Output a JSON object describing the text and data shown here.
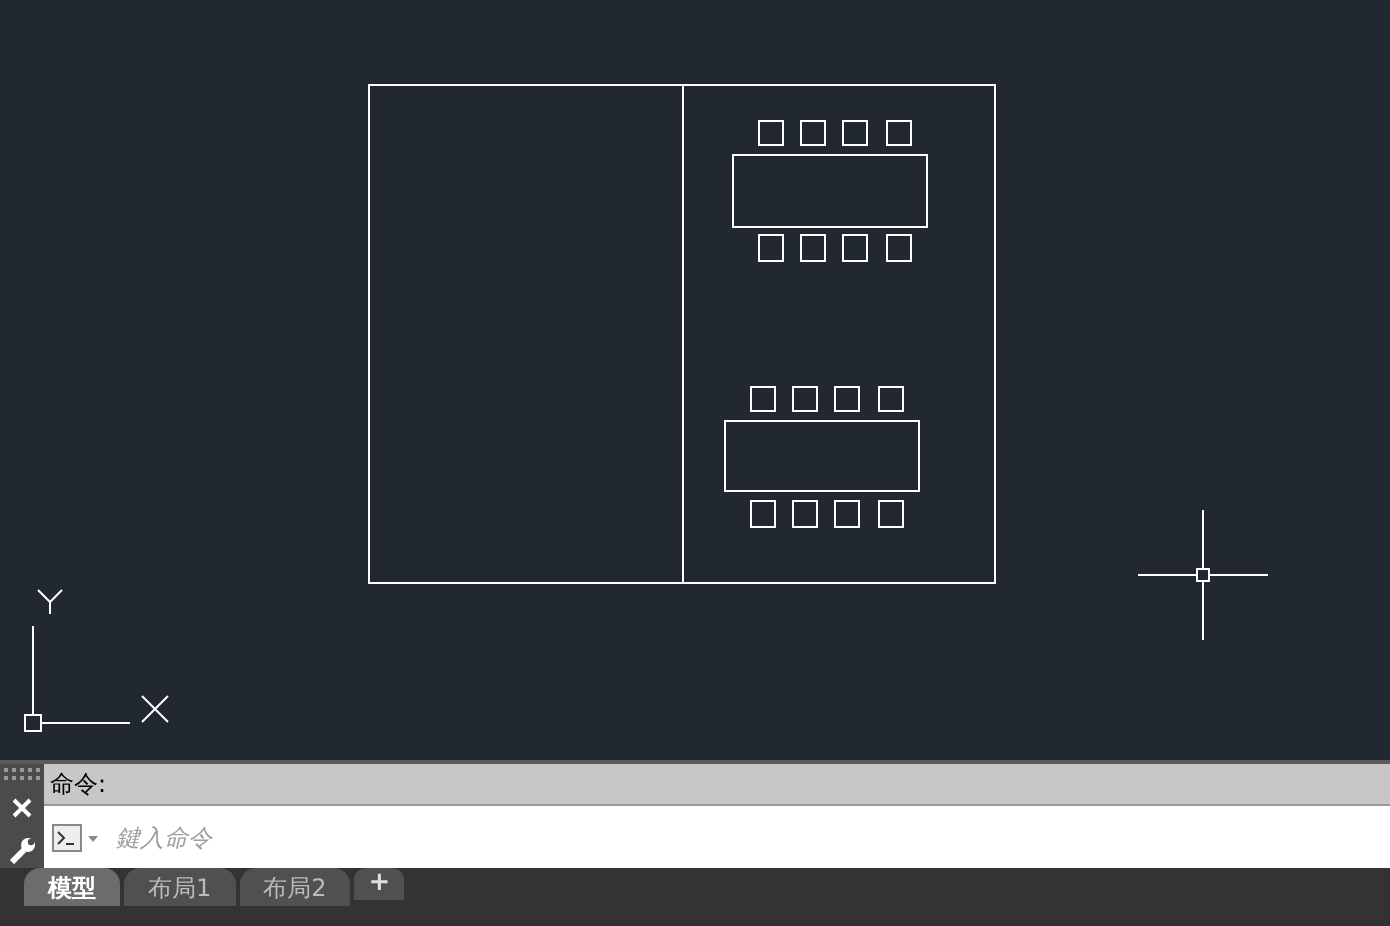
{
  "command_line": {
    "history": "命令:",
    "placeholder": "鍵入命令"
  },
  "layout_tabs": [
    {
      "label": "模型",
      "selected": true
    },
    {
      "label": "布局1",
      "selected": false
    },
    {
      "label": "布局2",
      "selected": false
    }
  ],
  "add_tab": "+"
}
